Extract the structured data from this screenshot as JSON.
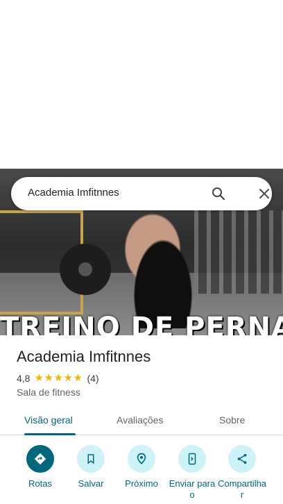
{
  "search": {
    "query": "Academia Imfitnnes"
  },
  "hero": {
    "caption": "TREINO DE PERNA"
  },
  "place": {
    "name": "Academia Imfitnnes",
    "rating": "4,8",
    "stars": 5,
    "review_count": "(4)",
    "category": "Sala de fitness"
  },
  "tabs": [
    {
      "label": "Visão geral",
      "active": true
    },
    {
      "label": "Avaliações",
      "active": false
    },
    {
      "label": "Sobre",
      "active": false
    }
  ],
  "actions": [
    {
      "label": "Rotas",
      "icon": "directions-icon"
    },
    {
      "label": "Salvar",
      "icon": "bookmark-icon"
    },
    {
      "label": "Próximo",
      "icon": "nearby-icon"
    },
    {
      "label": "Enviar para o",
      "icon": "send-to-phone-icon"
    },
    {
      "label": "Compartilhar",
      "icon": "share-icon"
    }
  ],
  "colors": {
    "accent": "#00687a",
    "accent_light": "#cdf2f8",
    "star": "#f4b400",
    "text_primary": "#202124",
    "text_secondary": "#5f6368"
  }
}
